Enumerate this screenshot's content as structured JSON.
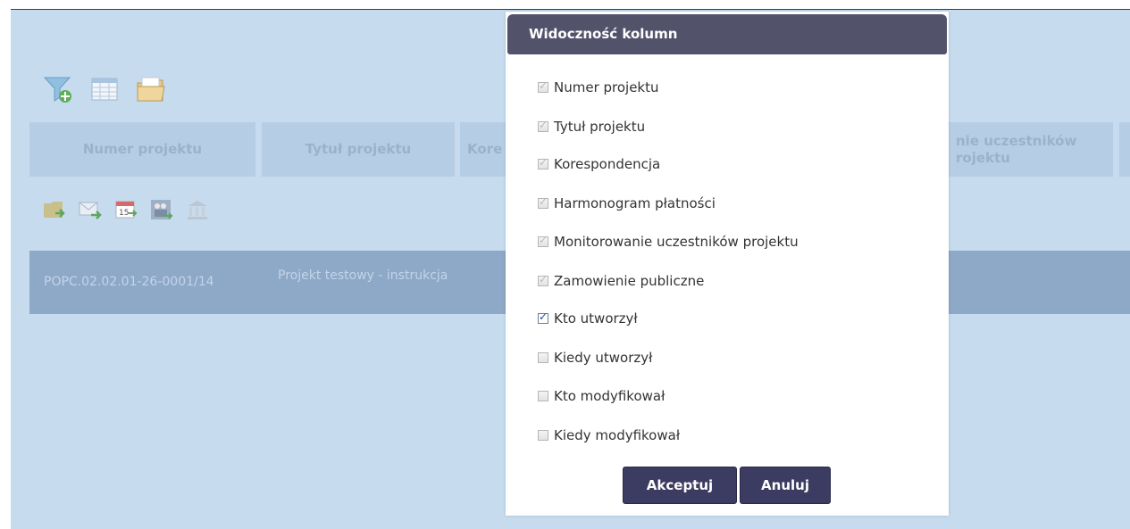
{
  "toolbar": {
    "icons": [
      "filter-add-icon",
      "table-icon",
      "folder-icon"
    ]
  },
  "table": {
    "headers": [
      "Numer projektu",
      "Tytuł projektu",
      "Kore",
      "nie uczestników\nrojektu"
    ],
    "row_action_icons": [
      "folder-arrow-icon",
      "mail-arrow-icon",
      "calendar-icon",
      "people-icon",
      "bank-icon"
    ],
    "row": {
      "numer": "POPC.02.02.01-26-0001/14",
      "tytul": "Projekt testowy - instrukcja"
    }
  },
  "modal": {
    "title": "Widoczność kolumn",
    "options": [
      {
        "label": "Numer projektu",
        "checked": true,
        "disabled": true
      },
      {
        "label": "Tytuł projektu",
        "checked": true,
        "disabled": true
      },
      {
        "label": "Korespondencja",
        "checked": true,
        "disabled": true
      },
      {
        "label": "Harmonogram płatności",
        "checked": true,
        "disabled": true
      },
      {
        "label": "Monitorowanie uczestników projektu",
        "checked": true,
        "disabled": true
      },
      {
        "label": "Zamowienie publiczne",
        "checked": true,
        "disabled": true
      },
      {
        "label": "Kto utworzył",
        "checked": true,
        "disabled": false
      },
      {
        "label": "Kiedy utworzył",
        "checked": false,
        "disabled": false
      },
      {
        "label": "Kto modyfikował",
        "checked": false,
        "disabled": false
      },
      {
        "label": "Kiedy modyfikował",
        "checked": false,
        "disabled": false
      }
    ],
    "accept_label": "Akceptuj",
    "cancel_label": "Anuluj"
  },
  "colors": {
    "page_bg": "#c6dbee",
    "header_cell": "#b6cde6",
    "row_bg": "#8ea8c8",
    "modal_header": "#52526b",
    "button": "#3c3b61"
  }
}
